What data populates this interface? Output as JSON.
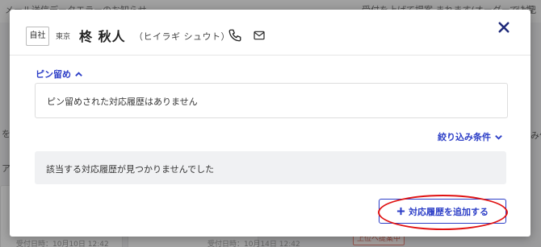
{
  "background": {
    "top_texts": [
      "メール送信データエラーのお知らせ",
      "受付を上げて提案 まれます(オーダーで上記",
      "に提"
    ],
    "side_texts": [
      "を",
      "ア",
      "012",
      "ジェ",
      "み作"
    ],
    "dates": [
      "受付日時：10月10日 12:42",
      "受付日時：10月14日 12:42"
    ],
    "tag": "上位へ提案中"
  },
  "modal": {
    "badge": "自社",
    "region": "東京",
    "customer_name": "柊 秋人",
    "customer_kana": "（ヒイラギ シュウト）",
    "pin_section": {
      "toggle_label": "ピン留め",
      "empty_text": "ピン留めされた対応履歴はありません"
    },
    "filter_label": "絞り込み条件",
    "empty_history_text": "該当する対応履歴が見つかりませんでした",
    "add_button_label": "対応履歴を追加する"
  },
  "colors": {
    "accent": "#2c3ec7",
    "highlight": "#e01212"
  }
}
